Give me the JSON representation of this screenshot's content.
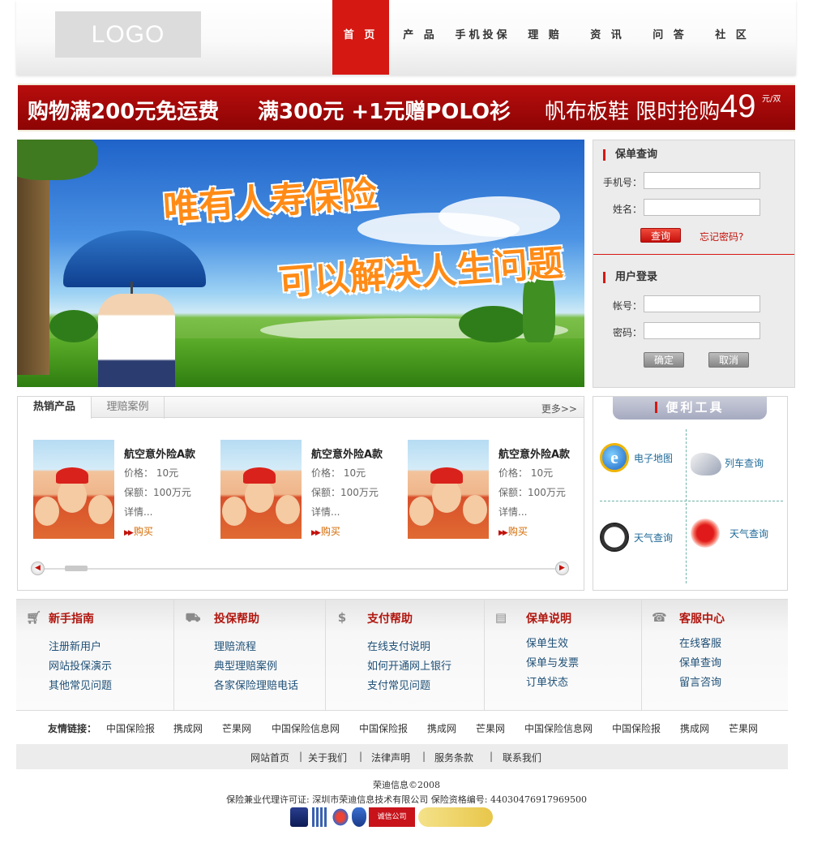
{
  "header": {
    "logo_text": "LOGO",
    "nav": [
      "首 页",
      "产 品",
      "手机投保",
      "理 赔",
      "资 讯",
      "问 答",
      "社 区"
    ],
    "active_nav": 0
  },
  "promo": {
    "part1": "购物满200元免运费",
    "part2": "满300元 +1元赠POLO衫",
    "part3": "帆布板鞋 限时抢购",
    "price": "49",
    "unit": "元/双"
  },
  "hero": {
    "slogan_line1": "唯有人寿保险",
    "slogan_line2": "可以解决人生问题"
  },
  "policy_query": {
    "title": "保单查询",
    "phone_label": "手机号：",
    "name_label": "姓名：",
    "phone_value": "",
    "name_value": "",
    "query_button": "查询",
    "forgot_link": "忘记密码?"
  },
  "user_login": {
    "title": "用户登录",
    "account_label": "帐号：",
    "password_label": "密码：",
    "account_value": "",
    "password_value": "",
    "confirm_button": "确定",
    "cancel_button": "取消"
  },
  "products": {
    "tabs": [
      "热销产品",
      "理赔案例"
    ],
    "more": "更多>>",
    "items": [
      {
        "name": "航空意外险A款",
        "price": "价格： 10元",
        "coverage": "保额：100万元",
        "details": "详情...",
        "buy": "购买"
      },
      {
        "name": "航空意外险A款",
        "price": "价格： 10元",
        "coverage": "保额：100万元",
        "details": "详情...",
        "buy": "购买"
      },
      {
        "name": "航空意外险A款",
        "price": "价格： 10元",
        "coverage": "保额：100万元",
        "details": "详情...",
        "buy": "购买"
      }
    ],
    "slider_position": 0.05
  },
  "tools": {
    "title": "便利工具",
    "items": [
      {
        "label": "电子地图",
        "icon": "ie-icon"
      },
      {
        "label": "列车查询",
        "icon": "train-icon"
      },
      {
        "label": "天气查询",
        "icon": "clock-icon"
      },
      {
        "label": "天气查询",
        "icon": "sun-icon"
      }
    ]
  },
  "guide": {
    "columns": [
      {
        "title": "新手指南",
        "icon": "cart-icon",
        "links": [
          "注册新用户",
          "网站投保演示",
          "其他常见问题"
        ]
      },
      {
        "title": "投保帮助",
        "icon": "car-icon",
        "links": [
          "理赔流程",
          "典型理赔案例",
          "各家保险理赔电话"
        ]
      },
      {
        "title": "支付帮助",
        "icon": "dollar-icon",
        "links": [
          "在线支付说明",
          "如何开通网上银行",
          "支付常见问题"
        ]
      },
      {
        "title": "保单说明",
        "icon": "document-icon",
        "links": [
          "保单生效",
          "保单与发票",
          "订单状态"
        ]
      },
      {
        "title": "客服中心",
        "icon": "support-icon",
        "links": [
          "在线客服",
          "保单查询",
          "留言咨询"
        ]
      }
    ]
  },
  "friend_links": {
    "label": "友情链接：",
    "links": [
      "中国保险报",
      "携成网",
      "芒果网",
      "中国保险信息网",
      "中国保险报",
      "携成网",
      "芒果网",
      "中国保险信息网",
      "中国保险报",
      "携成网",
      "芒果网"
    ]
  },
  "bottom_nav": {
    "items": [
      "网站首页",
      "关于我们",
      "法律声明",
      "服务条款",
      "联系我们"
    ],
    "separator": "|"
  },
  "copyright": {
    "line1": "荣迪信息©2008",
    "line2": "保险兼业代理许可证: 深圳市荣迪信息技术有限公司  保险资格编号: 44030476917969500"
  },
  "badges": {
    "b4": "诚信公司"
  },
  "colors": {
    "brand_red": "#d61812",
    "promo_red": "#a50808",
    "link_blue": "#1f5077",
    "guide_title": "#b1160f"
  }
}
